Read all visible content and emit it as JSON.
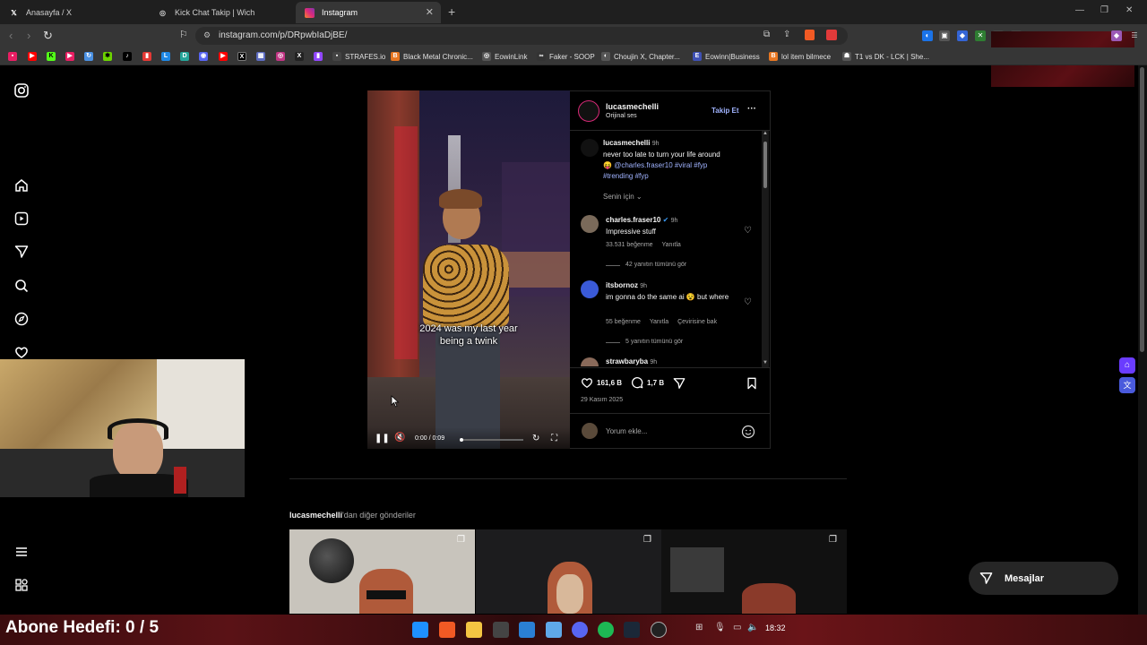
{
  "browser": {
    "tabs": [
      {
        "label": "Anasayfa / X",
        "icon": "x-logo-icon"
      },
      {
        "label": "Kick Chat Takip | Wich",
        "icon": "globe-icon"
      },
      {
        "label": "Instagram",
        "icon": "instagram-icon"
      }
    ],
    "url": "instagram.com/p/DRpwbIaDjBE/",
    "bookmarks": [
      {
        "label": "STRAFES.io"
      },
      {
        "label": "Black Metal Chronic..."
      },
      {
        "label": "EowinLink"
      },
      {
        "label": "Faker - SOOP"
      },
      {
        "label": "Choujin X, Chapter..."
      },
      {
        "label": "Eowinn|Business"
      },
      {
        "label": "lol item bilmece"
      },
      {
        "label": "T1 vs DK - LCK | She..."
      }
    ]
  },
  "post": {
    "author": "lucasmechelli",
    "audio": "Orijinal ses",
    "follow_label": "Takip Et",
    "caption_author": "lucasmechelli",
    "caption_time": "9h",
    "caption_line1": "never too late to turn your life around",
    "caption_emoji": "😝",
    "caption_mention": "@charles.fraser10",
    "caption_tags_line1": "#viral #fyp",
    "caption_tags_line2": "#trending #fyp",
    "sort_label": "Senin için",
    "comments": [
      {
        "user": "charles.fraser10",
        "verified": true,
        "time": "9h",
        "text": "Impressive stuff",
        "likes": "33.531 beğenme",
        "reply": "Yanıtla",
        "see_replies": "42 yanıtın tümünü gör"
      },
      {
        "user": "itsbornoz",
        "verified": false,
        "time": "9h",
        "text": "im gonna do the same ai 😵 but where",
        "likes": "55 beğenme",
        "reply": "Yanıtla",
        "translate": "Çevirisine bak",
        "see_replies": "5 yanıtın tümünü gör"
      },
      {
        "user": "strawbaryba",
        "time": "9h"
      }
    ],
    "like_count": "161,6 B",
    "comment_count": "1,7 B",
    "date": "29 Kasım 2025",
    "comment_placeholder": "Yorum ekle...",
    "video_caption_line1": "2024 was my last year",
    "video_caption_line2": "being a twink",
    "video_time": "0:00 / 0:09",
    "video_progress": 0
  },
  "more_posts": {
    "author": "lucasmechelli",
    "suffix": "'dan diğer gönderiler"
  },
  "messages_label": "Mesajlar",
  "overlay": {
    "abone": "Abone Hedefi:  0 / 5",
    "clock": "18:32"
  }
}
